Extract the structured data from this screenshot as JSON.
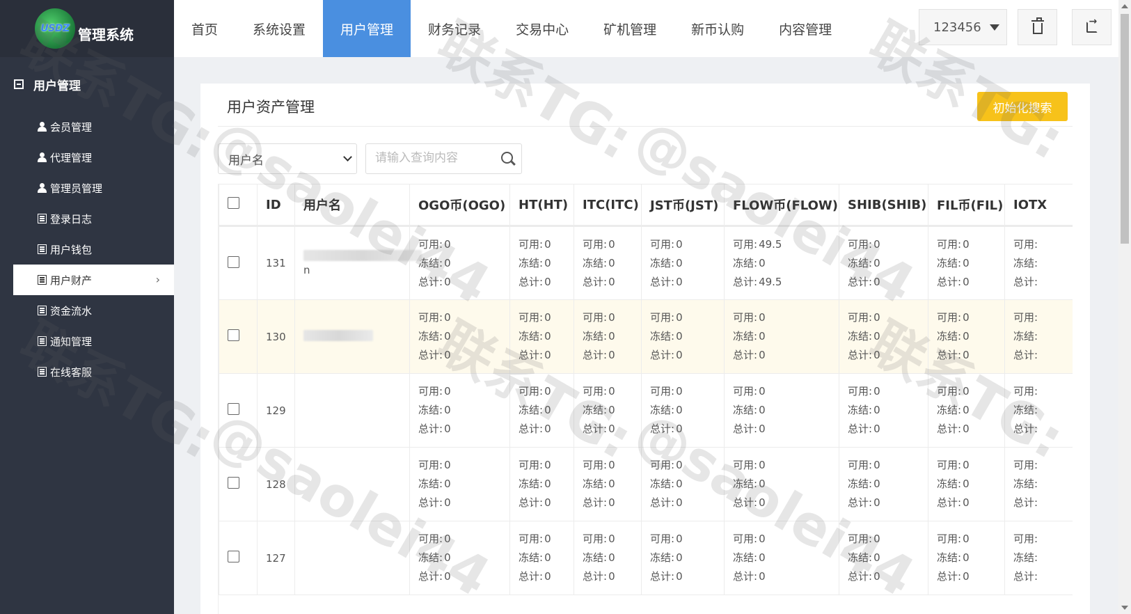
{
  "app": {
    "logo_text": "USDZ",
    "title": "管理系统"
  },
  "sidebar": {
    "group_label": "用户管理",
    "items": [
      {
        "label": "会员管理",
        "icon": "user-icon"
      },
      {
        "label": "代理管理",
        "icon": "user-icon"
      },
      {
        "label": "管理员管理",
        "icon": "user-icon"
      },
      {
        "label": "登录日志",
        "icon": "list-icon"
      },
      {
        "label": "用户钱包",
        "icon": "list-icon"
      },
      {
        "label": "用户财产",
        "icon": "list-icon",
        "active": true
      },
      {
        "label": "资金流水",
        "icon": "list-icon"
      },
      {
        "label": "通知管理",
        "icon": "list-icon"
      },
      {
        "label": "在线客服",
        "icon": "list-icon"
      }
    ]
  },
  "topnav": {
    "tabs": [
      "首页",
      "系统设置",
      "用户管理",
      "财务记录",
      "交易中心",
      "矿机管理",
      "新币认购",
      "内容管理"
    ],
    "active_tab": "用户管理",
    "user": "123456"
  },
  "page": {
    "title": "用户资产管理",
    "reset_button": "初始化搜索",
    "filter_select": "用户名",
    "search_placeholder": "请输入查询内容"
  },
  "table": {
    "headers": [
      "ID",
      "用户名",
      "OGO币(OGO)",
      "HT(HT)",
      "ITC(ITC)",
      "JST币(JST)",
      "FLOW币(FLOW)",
      "SHIB(SHIB)",
      "FIL币(FIL)",
      "IOTX"
    ],
    "stat_labels": {
      "available": "可用:",
      "frozen": "冻结:",
      "total": "总计:"
    },
    "rows": [
      {
        "id": "131",
        "username_suffix": "n",
        "coins": [
          [
            "0",
            "0",
            "0"
          ],
          [
            "0",
            "0",
            "0"
          ],
          [
            "0",
            "0",
            "0"
          ],
          [
            "0",
            "0",
            "0"
          ],
          [
            "49.5",
            "0",
            "49.5"
          ],
          [
            "0",
            "0",
            "0"
          ],
          [
            "0",
            "0",
            "0"
          ],
          [
            "",
            "",
            ""
          ]
        ]
      },
      {
        "id": "130",
        "username_suffix": "",
        "coins": [
          [
            "0",
            "0",
            "0"
          ],
          [
            "0",
            "0",
            "0"
          ],
          [
            "0",
            "0",
            "0"
          ],
          [
            "0",
            "0",
            "0"
          ],
          [
            "0",
            "0",
            "0"
          ],
          [
            "0",
            "0",
            "0"
          ],
          [
            "0",
            "0",
            "0"
          ],
          [
            "",
            "",
            ""
          ]
        ]
      },
      {
        "id": "129",
        "username_suffix": "",
        "coins": [
          [
            "0",
            "0",
            "0"
          ],
          [
            "0",
            "0",
            "0"
          ],
          [
            "0",
            "0",
            "0"
          ],
          [
            "0",
            "0",
            "0"
          ],
          [
            "0",
            "0",
            "0"
          ],
          [
            "0",
            "0",
            "0"
          ],
          [
            "0",
            "0",
            "0"
          ],
          [
            "",
            "",
            ""
          ]
        ]
      },
      {
        "id": "128",
        "username_suffix": "",
        "coins": [
          [
            "0",
            "0",
            "0"
          ],
          [
            "0",
            "0",
            "0"
          ],
          [
            "0",
            "0",
            "0"
          ],
          [
            "0",
            "0",
            "0"
          ],
          [
            "0",
            "0",
            "0"
          ],
          [
            "0",
            "0",
            "0"
          ],
          [
            "0",
            "0",
            "0"
          ],
          [
            "",
            "",
            ""
          ]
        ]
      },
      {
        "id": "127",
        "username_suffix": "",
        "coins": [
          [
            "0",
            "0",
            "0"
          ],
          [
            "0",
            "0",
            "0"
          ],
          [
            "0",
            "0",
            "0"
          ],
          [
            "0",
            "0",
            "0"
          ],
          [
            "0",
            "0",
            "0"
          ],
          [
            "0",
            "0",
            "0"
          ],
          [
            "0",
            "0",
            "0"
          ],
          [
            "",
            "",
            ""
          ]
        ]
      }
    ]
  },
  "watermark": {
    "line1": "联系TG:",
    "line2": "@saolei44"
  },
  "colors": {
    "sidebar_bg": "#2f3542",
    "active_tab": "#4a8fe0",
    "reset_button": "#f7c21a",
    "highlight_row": "#fefaec"
  }
}
